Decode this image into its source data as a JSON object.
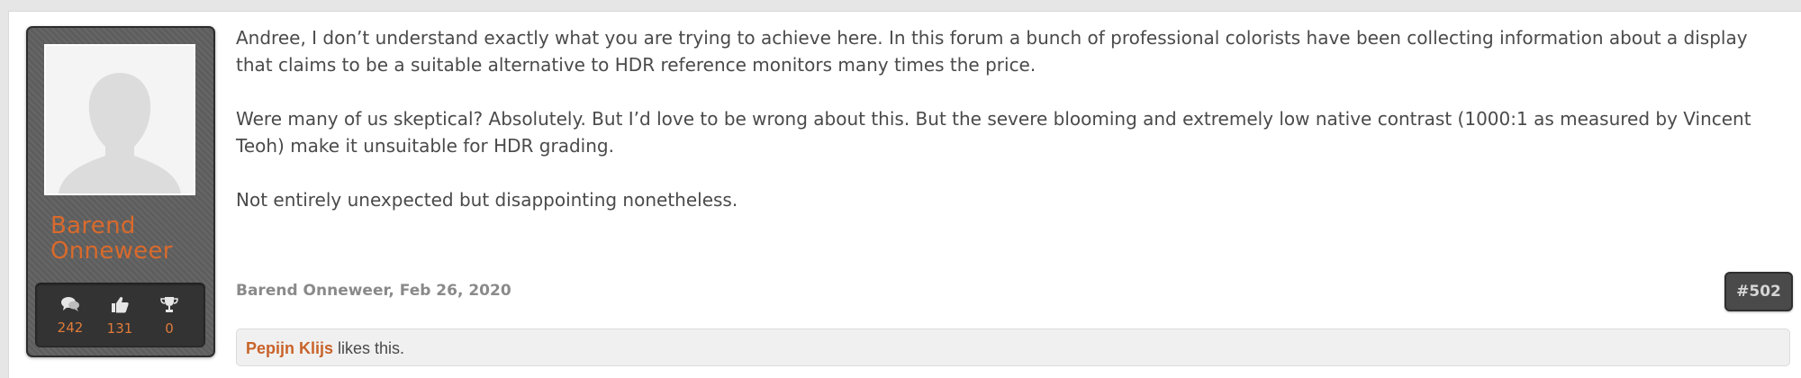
{
  "user": {
    "name": "Barend Onneweer",
    "stats": [
      {
        "icon": "speech-bubbles-icon",
        "value": "242"
      },
      {
        "icon": "thumbs-up-icon",
        "value": "131"
      },
      {
        "icon": "trophy-icon",
        "value": "0"
      }
    ]
  },
  "message": {
    "paragraphs": [
      "Andree, I don’t understand exactly what you are trying to achieve here. In this forum a bunch of professional colorists have been collecting information about a display that claims to be a suitable alternative to HDR reference monitors many times the price.",
      "Were many of us skeptical? Absolutely. But I’d love to be wrong about this. But the severe blooming and extremely low native contrast (1000:1 as measured by Vincent Teoh) make it unsuitable for HDR grading.",
      "Not entirely unexpected but disappointing nonetheless."
    ]
  },
  "meta": {
    "author": "Barend Onneweer",
    "separator": ",",
    "date": "Feb 26, 2020",
    "post_number": "#502"
  },
  "likes": {
    "liker": "Pepijn Klijs",
    "suffix": " likes this."
  },
  "colors": {
    "accent": "#d96a2c",
    "card_bg": "#5d5d5d",
    "stats_bg": "#333333"
  }
}
